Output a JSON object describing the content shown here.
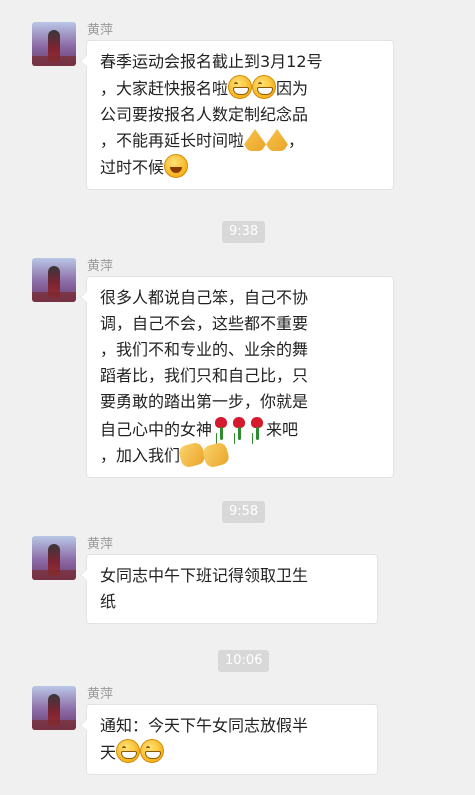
{
  "sender_name": "黄萍",
  "messages": [
    {
      "id": "m1",
      "lines": [
        {
          "text": "春季运动会报名截止到3月12号"
        },
        {
          "text": "，大家赶快报名啦",
          "emojis": [
            "grin-icon",
            "grin-icon"
          ],
          "after": "因为"
        },
        {
          "text": "公司要按报名人数定制纪念品"
        },
        {
          "text": "，不能再延长时间啦",
          "emojis": [
            "pray-icon",
            "pray-icon"
          ],
          "after": "，"
        },
        {
          "text": "过时不候",
          "emojis": [
            "laugh-cry-icon"
          ],
          "after": ""
        }
      ]
    },
    {
      "id": "m2",
      "lines": [
        {
          "text": "很多人都说自己笨，自己不协"
        },
        {
          "text": "调，自己不会，这些都不重要"
        },
        {
          "text": "，我们不和专业的、业余的舞"
        },
        {
          "text": "蹈者比，我们只和自己比，只"
        },
        {
          "text": "要勇敢的踏出第一步，你就是"
        },
        {
          "text": "自己心中的女神",
          "emojis": [
            "rose-icon",
            "rose-icon",
            "rose-icon"
          ],
          "after": "来吧"
        },
        {
          "text": "，加入我们",
          "emojis": [
            "clap-icon",
            "clap-icon"
          ],
          "after": ""
        }
      ]
    },
    {
      "id": "m3",
      "lines": [
        {
          "text": "女同志中午下班记得领取卫生"
        },
        {
          "text": "纸"
        }
      ]
    },
    {
      "id": "m4",
      "lines": [
        {
          "text": "通知：今天下午女同志放假半"
        },
        {
          "text": "天",
          "emojis": [
            "grin-icon",
            "grin-icon"
          ],
          "after": ""
        }
      ]
    }
  ],
  "timestamps": [
    "9:38",
    "9:58",
    "10:06"
  ]
}
